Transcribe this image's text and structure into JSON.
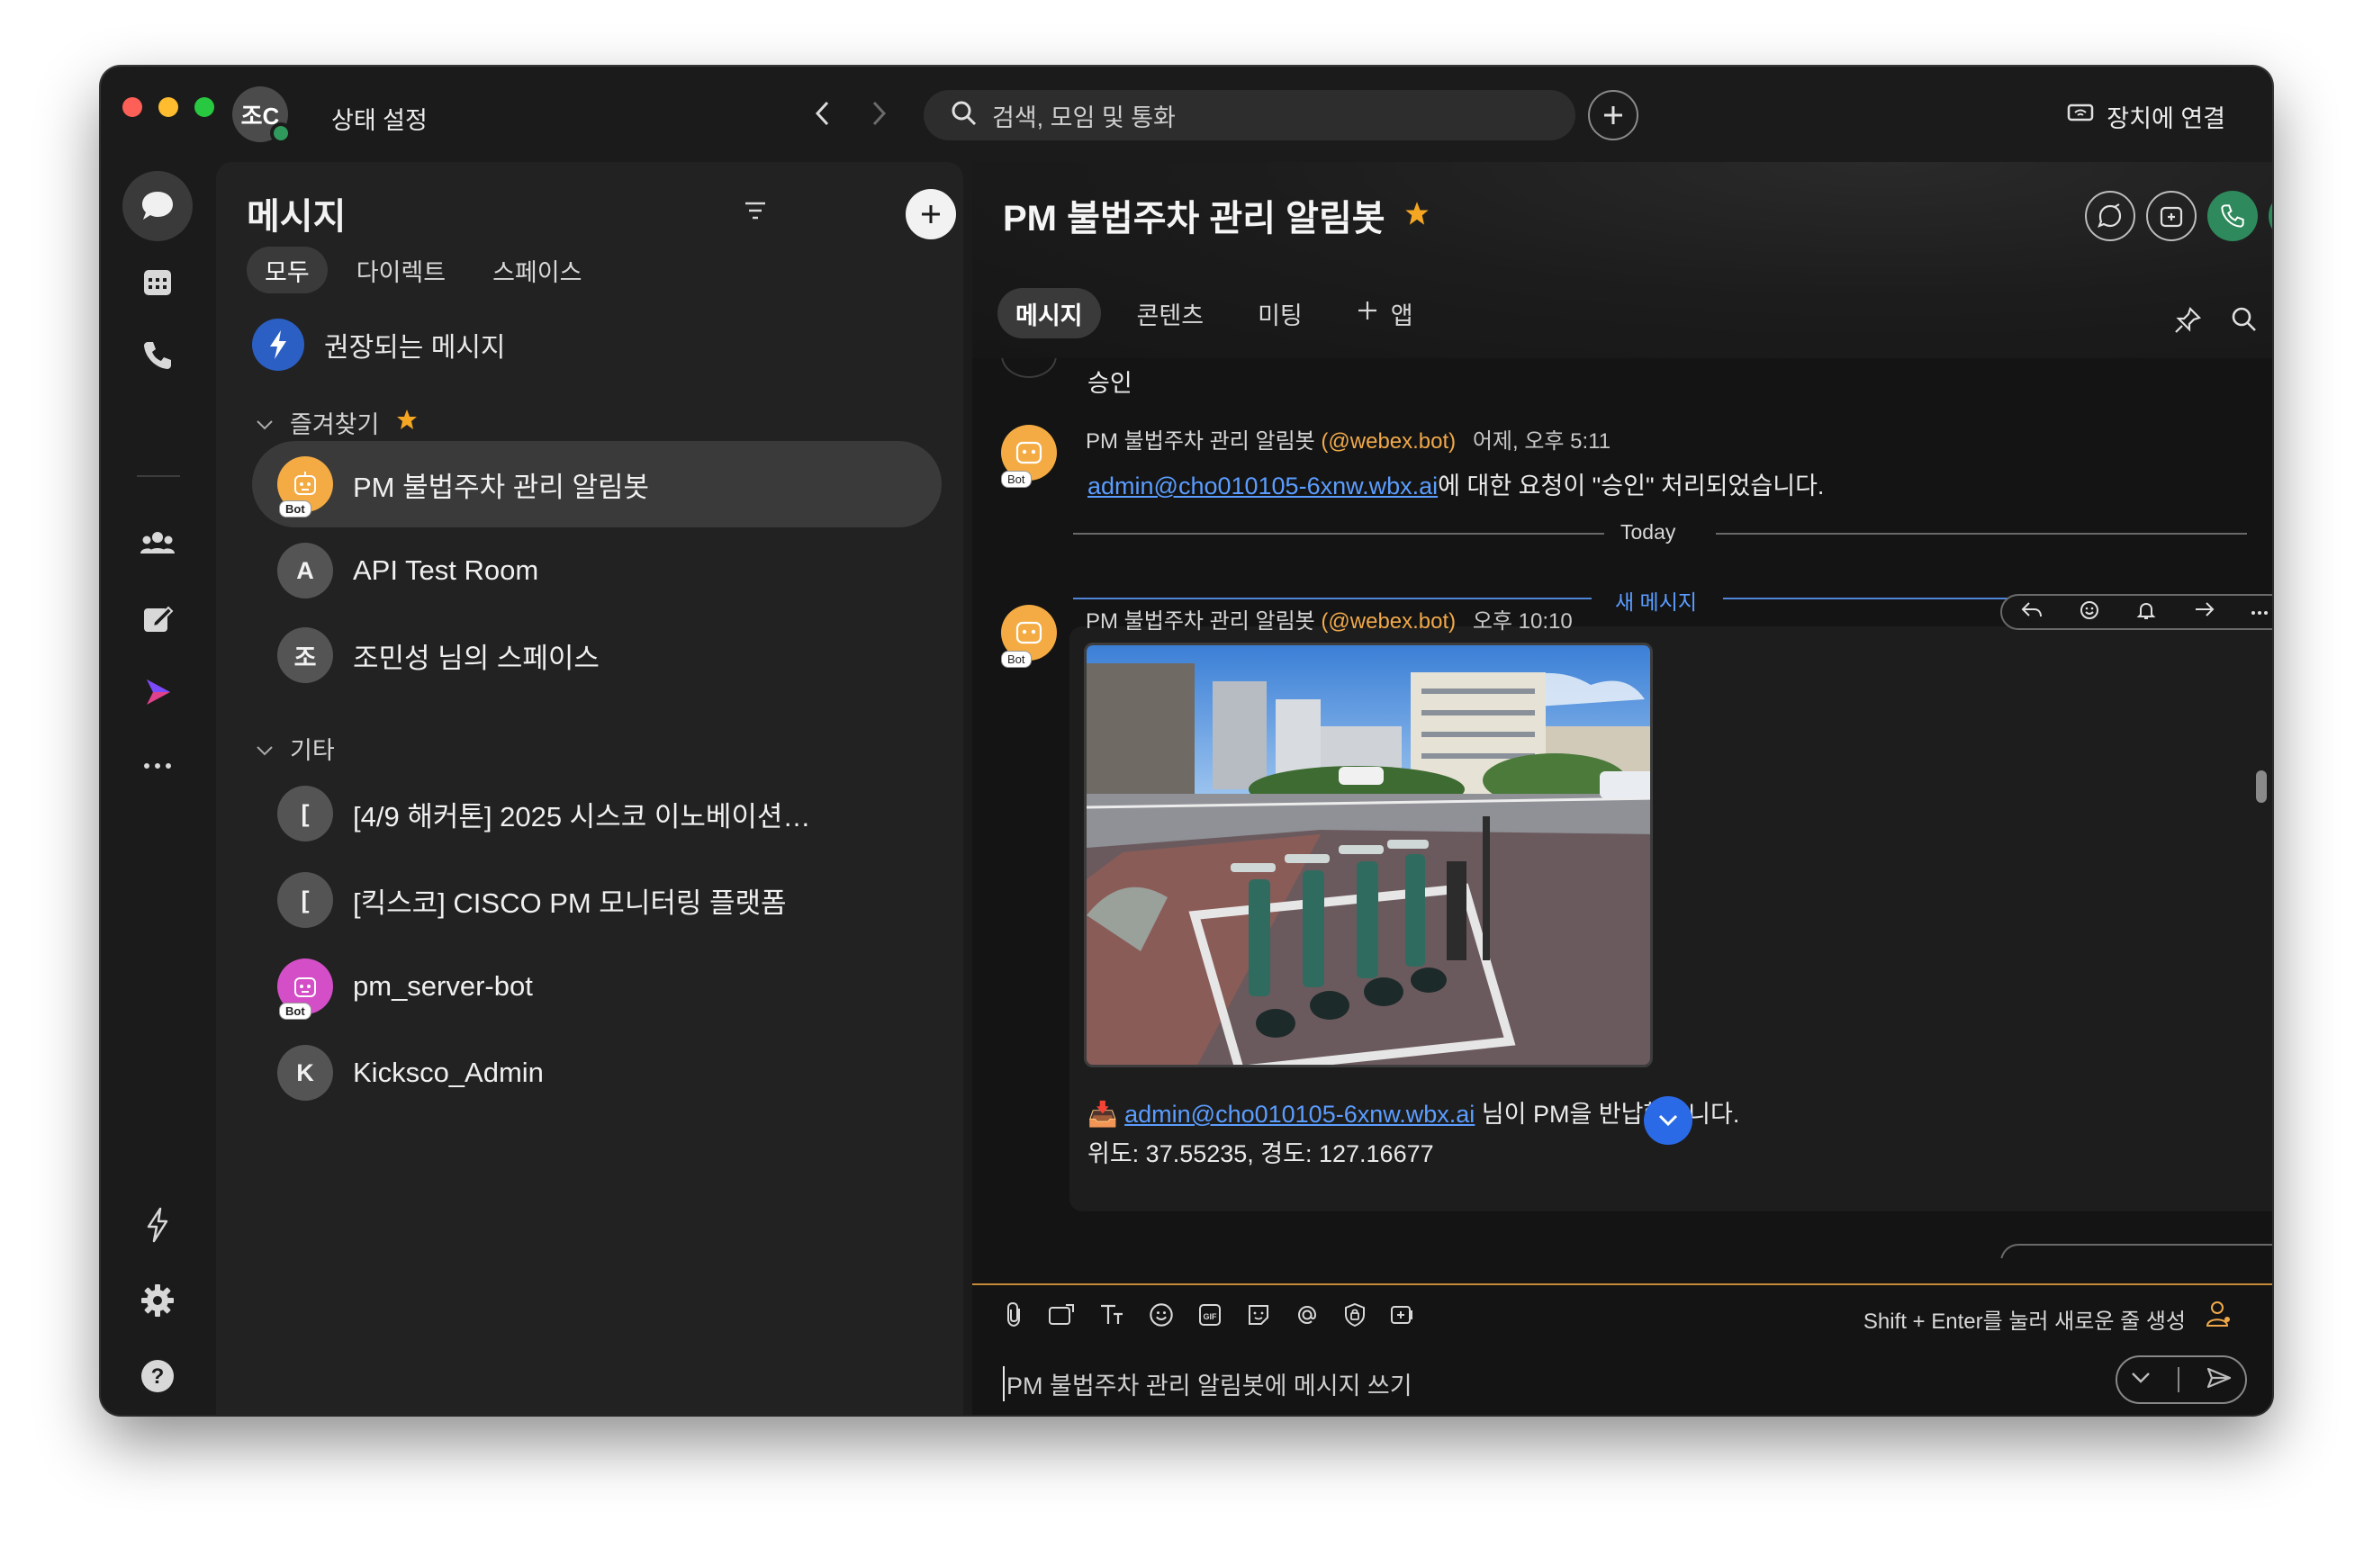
{
  "titlebar": {
    "me_initials": "조C",
    "status_label": "상태 설정",
    "search_placeholder": "검색, 모임 및 통화",
    "connect_label": "장치에 연결"
  },
  "panel": {
    "title": "메시지",
    "tabs": [
      "모두",
      "다이렉트",
      "스페이스"
    ],
    "recommended_label": "권장되는 메시지",
    "favorites_label": "즐겨찾기",
    "favorites": [
      {
        "initial": "",
        "label": "PM 불법주차 관리 알림봇",
        "bot_tag": "Bot"
      },
      {
        "initial": "A",
        "label": "API Test Room"
      },
      {
        "initial": "조",
        "label": "조민성 님의 스페이스"
      }
    ],
    "others_label": "기타",
    "others": [
      {
        "initial": "[",
        "label": "[4/9 해커톤] 2025 시스코 이노베이션…"
      },
      {
        "initial": "[",
        "label": "[킥스코] CISCO PM 모니터링 플랫폼"
      },
      {
        "initial": "",
        "label": "pm_server-bot",
        "bot_tag": "Bot"
      },
      {
        "initial": "K",
        "label": "Kicksco_Admin"
      }
    ]
  },
  "chat": {
    "title": "PM 불법주차 관리 알림봇",
    "tabs": [
      "메시지",
      "콘텐츠",
      "미팅",
      "앱"
    ],
    "prev_message_tail": "승인",
    "msg1": {
      "bot_tag": "Bot",
      "sender": "PM 불법주차 관리 알림봇",
      "handle": "(@webex.bot)",
      "time": "어제, 오후 5:11",
      "link": "admin@cho010105-6xnw.wbx.ai",
      "text": "에 대한 요청이 \"승인\" 처리되었습니다."
    },
    "divider_today": "Today",
    "divider_new": "새 메시지",
    "msg2": {
      "bot_tag": "Bot",
      "sender": "PM 불법주차 관리 알림봇",
      "handle": "(@webex.bot)",
      "time": "오후 10:10",
      "emoji": "📥",
      "link": "admin@cho010105-6xnw.wbx.ai",
      "text": " 님이 PM을 반납했습니다.",
      "coords": "위도: 37.55235, 경도: 127.16677"
    },
    "composer_hint": "Shift + Enter를 눌러 새로운 줄 생성",
    "composer_placeholder": "PM 불법주차 관리 알림봇에 메시지 쓰기"
  },
  "colors": {
    "accent_blue": "#5b9dff",
    "bot_orange": "#f4ab43",
    "star": "#f5a623",
    "call_green": "#2e8a5c",
    "composer_focus": "#c58a38"
  }
}
